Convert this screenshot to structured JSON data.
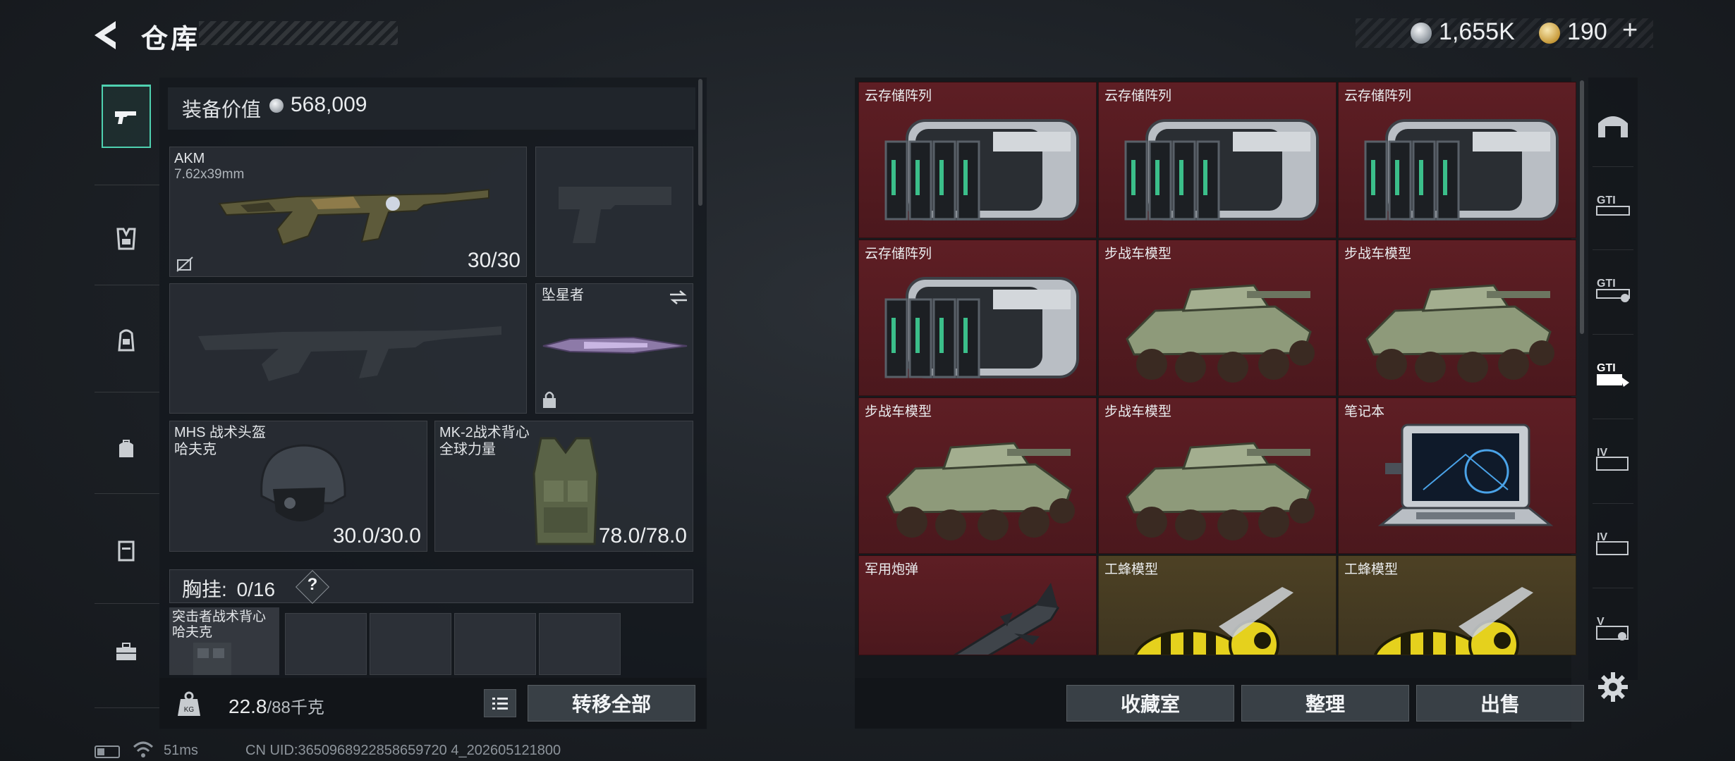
{
  "header": {
    "title": "仓库",
    "currency_silver": "1,655K",
    "currency_gold": "190",
    "currency_plus": "+"
  },
  "equipment": {
    "value_label": "装备价值",
    "value": "568,009",
    "primary_weapon": {
      "name": "AKM",
      "caliber": "7.62x39mm",
      "ammo": "30/30"
    },
    "melee": {
      "name": "坠星者"
    },
    "helmet": {
      "name": "MHS 战术头盔",
      "brand": "哈夫克",
      "durability": "30.0/30.0"
    },
    "armor": {
      "name": "MK-2战术背心",
      "brand": "全球力量",
      "durability": "78.0/78.0"
    },
    "chest": {
      "label": "胸挂:",
      "count": "0/16",
      "help": "?"
    },
    "rig": {
      "name": "突击者战术背心",
      "brand": "哈夫克"
    },
    "weight": {
      "current": "22.8",
      "capacity": "/88千克"
    },
    "transfer_all": "转移全部"
  },
  "storage": {
    "items": [
      {
        "name": "云存储阵列",
        "kind": "server",
        "rarity": "red"
      },
      {
        "name": "云存储阵列",
        "kind": "server",
        "rarity": "red"
      },
      {
        "name": "云存储阵列",
        "kind": "server",
        "rarity": "red"
      },
      {
        "name": "云存储阵列",
        "kind": "server",
        "rarity": "red"
      },
      {
        "name": "步战车模型",
        "kind": "vehicle",
        "rarity": "red"
      },
      {
        "name": "步战车模型",
        "kind": "vehicle",
        "rarity": "red"
      },
      {
        "name": "步战车模型",
        "kind": "vehicle",
        "rarity": "red"
      },
      {
        "name": "步战车模型",
        "kind": "vehicle",
        "rarity": "red"
      },
      {
        "name": "笔记本",
        "kind": "laptop",
        "rarity": "red"
      },
      {
        "name": "军用炮弹",
        "kind": "missile",
        "rarity": "red"
      },
      {
        "name": "工蜂模型",
        "kind": "bee",
        "rarity": "gold"
      },
      {
        "name": "工蜂模型",
        "kind": "bee",
        "rarity": "gold"
      }
    ],
    "buttons": {
      "collection": "收藏室",
      "organize": "整理",
      "sell": "出售"
    }
  },
  "right_rail": {
    "tabs": [
      "home-base-icon",
      "gti-container-1-icon",
      "gti-container-2-icon",
      "gti-container-3-icon",
      "iv-container-1-icon",
      "iv-container-2-icon",
      "v-container-icon"
    ]
  },
  "status": {
    "ping": "51ms",
    "uid": "CN UID:3650968922858659720 4_202605121800"
  },
  "colors": {
    "accent": "#4fd1b0",
    "rarity_red": "#5e1e24",
    "rarity_gold": "#4d4124"
  }
}
